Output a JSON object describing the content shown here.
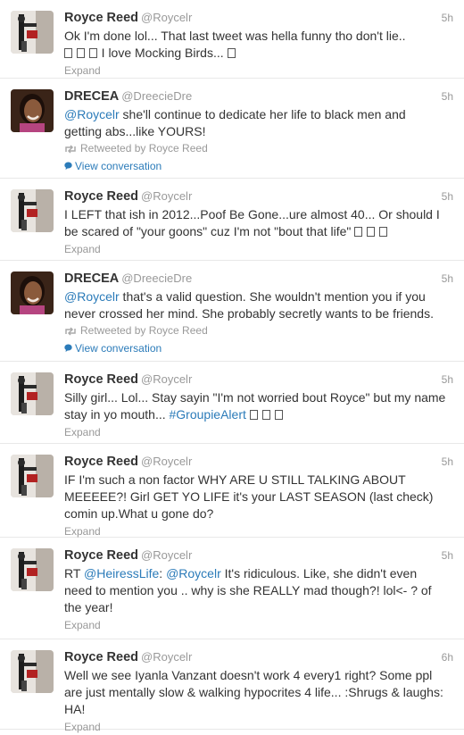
{
  "timeline": {
    "tweets": [
      {
        "author": "royce",
        "name": "Royce Reed",
        "handle": "@Roycelr",
        "time": "5h",
        "segments": [
          {
            "type": "text",
            "v": "Ok I'm done lol... That last tweet was hella funny tho don't lie.. "
          },
          {
            "type": "emoji",
            "n": 3
          },
          {
            "type": "text",
            "v": " I love Mocking Birds... "
          },
          {
            "type": "emoji",
            "n": 1
          }
        ],
        "footer": "Expand"
      },
      {
        "author": "drecea",
        "name": "DRECEA",
        "handle": "@DreecieDre",
        "time": "5h",
        "segments": [
          {
            "type": "mention",
            "v": "@Roycelr"
          },
          {
            "type": "text",
            "v": " she'll continue to dedicate her life to black men and getting abs...like YOURS!"
          }
        ],
        "retweeted_by": "Retweeted by Royce Reed",
        "conversation": "View conversation"
      },
      {
        "author": "royce",
        "name": "Royce Reed",
        "handle": "@Roycelr",
        "time": "5h",
        "segments": [
          {
            "type": "text",
            "v": "I LEFT that ish in 2012...Poof Be Gone...ure almost 40... Or should I be scared of \"your goons\" cuz I'm not \"bout that life\" "
          },
          {
            "type": "emoji",
            "n": 3
          }
        ],
        "footer": "Expand"
      },
      {
        "author": "drecea",
        "name": "DRECEA",
        "handle": "@DreecieDre",
        "time": "5h",
        "segments": [
          {
            "type": "mention",
            "v": "@Roycelr"
          },
          {
            "type": "text",
            "v": " that's a valid question. She wouldn't mention you if you never crossed her mind. She probably secretly wants to be friends."
          }
        ],
        "retweeted_by": "Retweeted by Royce Reed",
        "conversation": "View conversation"
      },
      {
        "author": "royce",
        "name": "Royce Reed",
        "handle": "@Roycelr",
        "time": "5h",
        "segments": [
          {
            "type": "text",
            "v": "Silly girl... Lol... Stay sayin \"I'm not worried bout Royce\" but my name stay in yo mouth... "
          },
          {
            "type": "hashtag",
            "v": "#GroupieAlert"
          },
          {
            "type": "text",
            "v": " "
          },
          {
            "type": "emoji",
            "n": 3
          }
        ],
        "footer": "Expand"
      },
      {
        "author": "royce",
        "name": "Royce Reed",
        "handle": "@Roycelr",
        "time": "5h",
        "segments": [
          {
            "type": "text",
            "v": "IF I'm such a non factor WHY ARE U STILL TALKING ABOUT MEEEEE?! Girl GET YO LIFE it's your LAST SEASON (last check) comin up.What u gone do?"
          }
        ],
        "footer": "Expand"
      },
      {
        "author": "royce",
        "name": "Royce Reed",
        "handle": "@Roycelr",
        "time": "5h",
        "segments": [
          {
            "type": "text",
            "v": "RT "
          },
          {
            "type": "mention",
            "v": "@HeiressLife"
          },
          {
            "type": "text",
            "v": ": "
          },
          {
            "type": "mention",
            "v": "@Roycelr"
          },
          {
            "type": "text",
            "v": " It's ridiculous. Like, she didn't even need to mention you .. why is she REALLY mad though?! lol<- ? of the year!"
          }
        ],
        "footer": "Expand"
      },
      {
        "author": "royce",
        "name": "Royce Reed",
        "handle": "@Roycelr",
        "time": "6h",
        "segments": [
          {
            "type": "text",
            "v": "Well we see Iyanla Vanzant doesn't work 4 every1 right? Some ppl are just mentally slow & walking hypocrites 4 life... :Shrugs & laughs: HA!"
          }
        ],
        "footer": "Expand"
      }
    ]
  },
  "icons": {
    "retweet": "retweet-icon",
    "conversation": "speech-bubble-icon",
    "emoji": "emoji-glyph-icon"
  },
  "colors": {
    "link": "#2b7bb9",
    "name": "#333333",
    "meta": "#999999",
    "divider": "#e8e8e8"
  }
}
